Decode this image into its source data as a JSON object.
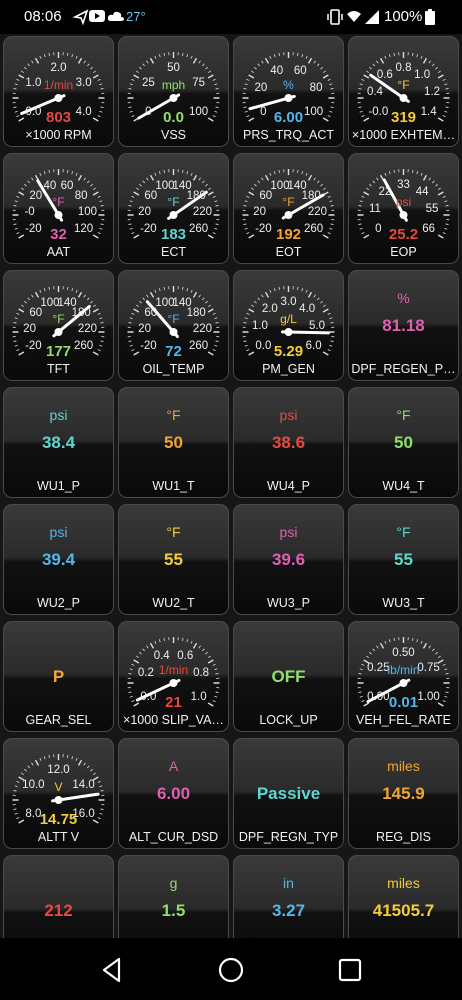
{
  "status_bar": {
    "time": "08:06",
    "weather_temp": "27°",
    "battery": "100%"
  },
  "colors": {
    "red": "#e8493f",
    "green": "#8fe06a",
    "blue": "#55b6e8",
    "orange": "#f3a533",
    "yellow": "#f4cc3a",
    "pink": "#e060b0",
    "teal": "#5fd6d0"
  },
  "gauges": [
    {
      "name": "×1000 RPM",
      "unit": "1/min",
      "value": "803",
      "needle": 0.03,
      "ticks": [
        "0.0",
        "1.0",
        "2.0",
        "3.0",
        "4.0"
      ],
      "unit_color": "red",
      "value_color": "red"
    },
    {
      "name": "VSS",
      "unit": "mph",
      "value": "0.0",
      "needle": 0.0,
      "ticks": [
        "0",
        "25",
        "50",
        "75",
        "100"
      ],
      "unit_color": "green",
      "value_color": "green"
    },
    {
      "name": "PRS_TRQ_ACT",
      "unit": "%",
      "value": "6.00",
      "needle": 0.06,
      "ticks": [
        "0",
        "20",
        "40",
        "60",
        "80",
        "100"
      ],
      "unit_color": "blue",
      "value_color": "blue"
    },
    {
      "name": "×1000 EXHTEM…",
      "unit": "°F",
      "value": "319",
      "needle": 0.27,
      "ticks": [
        "-0.0",
        "0.4",
        "0.6",
        "0.8",
        "1.0",
        "1.2",
        "1.4"
      ],
      "unit_color": "yellow",
      "value_color": "yellow"
    },
    {
      "name": "AAT",
      "unit": "°F",
      "value": "32",
      "needle": 0.37,
      "ticks": [
        "-20",
        "-0",
        "20",
        "40",
        "60",
        "80",
        "100",
        "120"
      ],
      "unit_color": "pink",
      "value_color": "pink"
    },
    {
      "name": "ECT",
      "unit": "°F",
      "value": "183",
      "needle": 0.73,
      "ticks": [
        "-20",
        "20",
        "60",
        "100",
        "140",
        "180",
        "220",
        "260"
      ],
      "unit_color": "teal",
      "value_color": "teal"
    },
    {
      "name": "EOT",
      "unit": "°F",
      "value": "192",
      "needle": 0.75,
      "ticks": [
        "-20",
        "20",
        "60",
        "100",
        "140",
        "180",
        "220",
        "260"
      ],
      "unit_color": "orange",
      "value_color": "orange"
    },
    {
      "name": "EOP",
      "unit": "psi",
      "value": "25.2",
      "needle": 0.38,
      "ticks": [
        "0",
        "11",
        "22",
        "33",
        "44",
        "55",
        "66"
      ],
      "unit_color": "red",
      "value_color": "red"
    },
    {
      "name": "TFT",
      "unit": "°F",
      "value": "177",
      "needle": 0.71,
      "ticks": [
        "-20",
        "20",
        "60",
        "100",
        "140",
        "180",
        "220",
        "260"
      ],
      "unit_color": "green",
      "value_color": "green"
    },
    {
      "name": "OIL_TEMP",
      "unit": "°F",
      "value": "72",
      "needle": 0.33,
      "ticks": [
        "-20",
        "20",
        "60",
        "100",
        "140",
        "180",
        "220",
        "260"
      ],
      "unit_color": "blue",
      "value_color": "blue"
    },
    {
      "name": "PM_GEN",
      "unit": "g/L",
      "value": "5.29",
      "needle": 0.88,
      "ticks": [
        "0.0",
        "1.0",
        "2.0",
        "3.0",
        "4.0",
        "5.0",
        "6.0"
      ],
      "unit_color": "yellow",
      "value_color": "yellow"
    },
    {
      "name": "×1000 SLIP_VA…",
      "unit": "1/min",
      "value": "21",
      "needle": 0.02,
      "ticks": [
        "0.0",
        "0.2",
        "0.4",
        "0.6",
        "0.8",
        "1.0"
      ],
      "unit_color": "red",
      "value_color": "red"
    },
    {
      "name": "VEH_FEL_RATE",
      "unit": "lb/min",
      "value": "0.01",
      "needle": 0.01,
      "ticks": [
        "0.00",
        "0.25",
        "0.50",
        "0.75",
        "1.00"
      ],
      "unit_color": "blue",
      "value_color": "blue"
    },
    {
      "name": "ALTT V",
      "unit": "V",
      "value": "14.75",
      "needle": 0.84,
      "ticks": [
        "8.0",
        "10.0",
        "12.0",
        "14.0",
        "16.0"
      ],
      "unit_color": "yellow",
      "value_color": "yellow"
    }
  ],
  "tiles": [
    {
      "name": "DPF_REGEN_P…",
      "unit": "%",
      "value": "81.18",
      "unit_color": "pink",
      "value_color": "pink"
    },
    {
      "name": "WU1_P",
      "unit": "psi",
      "value": "38.4",
      "unit_color": "teal",
      "value_color": "teal"
    },
    {
      "name": "WU1_T",
      "unit": "°F",
      "value": "50",
      "unit_color": "orange",
      "value_color": "orange"
    },
    {
      "name": "WU4_P",
      "unit": "psi",
      "value": "38.6",
      "unit_color": "red",
      "value_color": "red"
    },
    {
      "name": "WU4_T",
      "unit": "°F",
      "value": "50",
      "unit_color": "green",
      "value_color": "green"
    },
    {
      "name": "WU2_P",
      "unit": "psi",
      "value": "39.4",
      "unit_color": "blue",
      "value_color": "blue"
    },
    {
      "name": "WU2_T",
      "unit": "°F",
      "value": "55",
      "unit_color": "yellow",
      "value_color": "yellow"
    },
    {
      "name": "WU3_P",
      "unit": "psi",
      "value": "39.6",
      "unit_color": "pink",
      "value_color": "pink"
    },
    {
      "name": "WU3_T",
      "unit": "°F",
      "value": "55",
      "unit_color": "teal",
      "value_color": "teal"
    },
    {
      "name": "GEAR_SEL",
      "unit": "",
      "value": "P",
      "unit_color": "orange",
      "value_color": "orange"
    },
    {
      "name": "LOCK_UP",
      "unit": "",
      "value": "OFF",
      "unit_color": "green",
      "value_color": "green"
    },
    {
      "name": "ALT_CUR_DSD",
      "unit": "A",
      "value": "6.00",
      "unit_color": "pink",
      "value_color": "pink"
    },
    {
      "name": "DPF_REGN_TYP",
      "unit": "",
      "value": "Passive",
      "unit_color": "teal",
      "value_color": "teal"
    },
    {
      "name": "REG_DIS",
      "unit": "miles",
      "value": "145.9",
      "unit_color": "orange",
      "value_color": "orange"
    },
    {
      "name": "",
      "unit": "",
      "value": "212",
      "unit_color": "red",
      "value_color": "red"
    },
    {
      "name": "",
      "unit": "g",
      "value": "1.5",
      "unit_color": "green",
      "value_color": "green"
    },
    {
      "name": "",
      "unit": "in",
      "value": "3.27",
      "unit_color": "blue",
      "value_color": "blue"
    },
    {
      "name": "",
      "unit": "miles",
      "value": "41505.7",
      "unit_color": "yellow",
      "value_color": "yellow"
    }
  ],
  "nav": {
    "back": "back-icon",
    "home": "home-icon",
    "recents": "recents-icon"
  }
}
